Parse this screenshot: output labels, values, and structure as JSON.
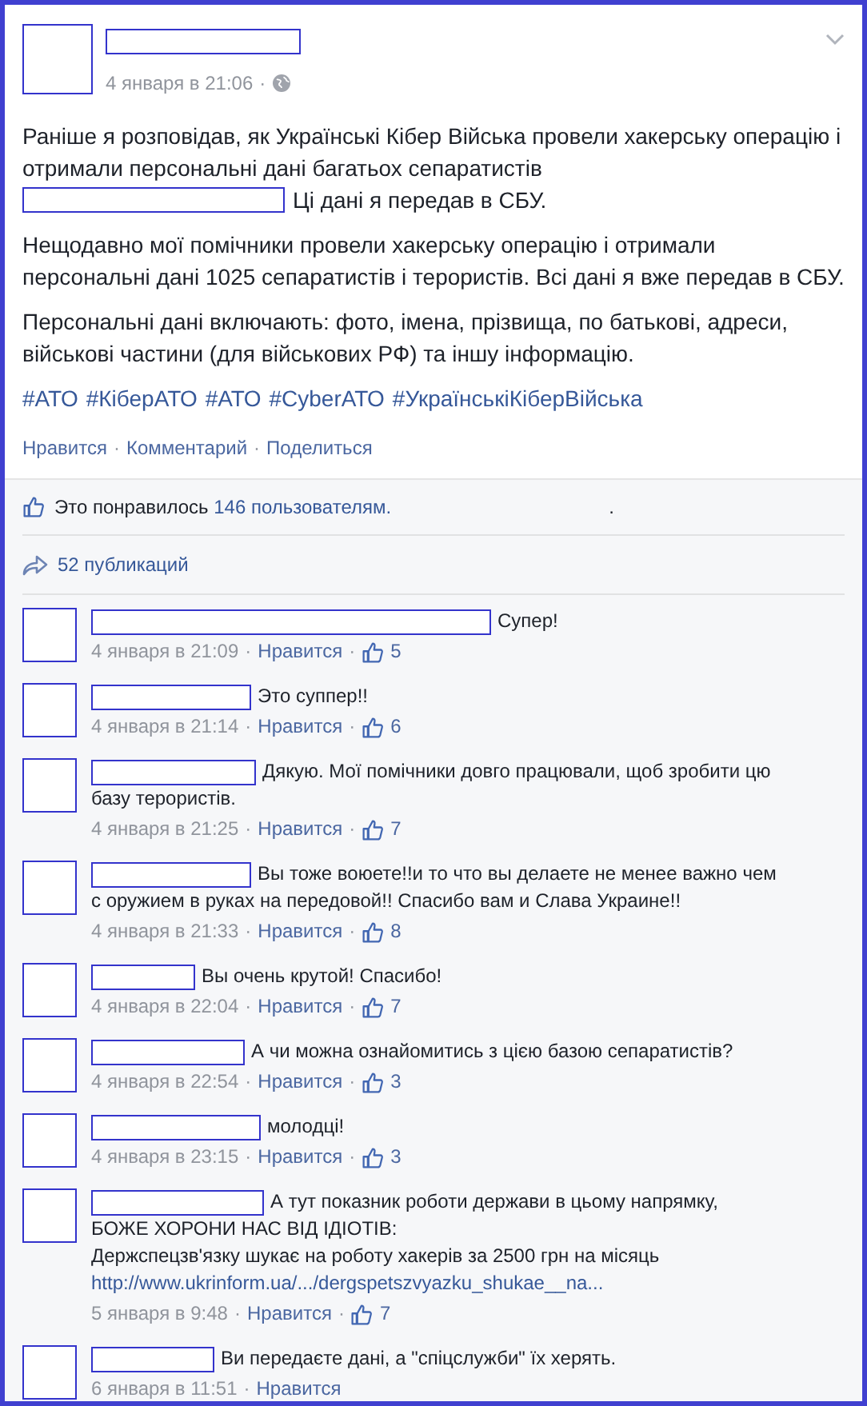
{
  "separator": "·",
  "post": {
    "time": "4 января в 21:06",
    "paragraphs": [
      [
        "Раніше я розповідав, як Українські Кібер Війська провели хакерську операцію і отримали персональні дані багатьох сепаратистів",
        "Ці дані я передав в СБУ."
      ],
      [
        "Нещодавно мої помічники провели хакерську операцію і отримали персональні дані 1025 сепаратистів і терористів. Всі дані я вже передав в СБУ."
      ],
      [
        "Персональні дані включають: фото, імена, прізвища, по батькові, адреси, військові частини (для військових РФ) та іншу інформацію."
      ]
    ],
    "hashtags": [
      "#АТО",
      "#КіберАТО",
      "#АТО",
      "#CyberАТО",
      "#УкраїнськіКіберВійська"
    ],
    "actions": [
      "Нравится",
      "Комментарий",
      "Поделиться"
    ]
  },
  "likes": {
    "prefix": "Это понравилось",
    "link": "146 пользователям.",
    "dot": "."
  },
  "shares": "52 публикаций",
  "comments": [
    {
      "lines": [
        "Супер!"
      ],
      "time": "4 января в 21:09",
      "like": "Нравится",
      "likes": "5"
    },
    {
      "lines": [
        "Это суппер!!"
      ],
      "time": "4 января в 21:14",
      "like": "Нравится",
      "likes": "6"
    },
    {
      "lines": [
        "Дякую. Мої помічники довго працювали, щоб зробити цю",
        "базу терористів."
      ],
      "time": "4 января в 21:25",
      "like": "Нравится",
      "likes": "7"
    },
    {
      "lines": [
        "Вы тоже воюете!!и то что вы делаете не менее важно чем",
        "с оружием в руках на передовой!! Спасибо вам и Слава Украине!!"
      ],
      "time": "4 января в 21:33",
      "like": "Нравится",
      "likes": "8"
    },
    {
      "lines": [
        "Вы очень крутой! Спасибо!"
      ],
      "time": "4 января в 22:04",
      "like": "Нравится",
      "likes": "7"
    },
    {
      "lines": [
        "А чи можна ознайомитись з цією базою сепаратистів?"
      ],
      "time": "4 января в 22:54",
      "like": "Нравится",
      "likes": "3"
    },
    {
      "lines": [
        "молодці!"
      ],
      "time": "4 января в 23:15",
      "like": "Нравится",
      "likes": "3"
    },
    {
      "lines": [
        "А тут показник роботи держави в цьому напрямку,",
        "БОЖЕ ХОРОНИ НАС ВІД ІДІОТІВ:",
        "Держспецзв'язку шукає на роботу хакерів за 2500 грн на місяць"
      ],
      "link": "http://www.ukrinform.ua/.../dergspetszvyazku_shukae__na...",
      "time": "5 января в 9:48",
      "like": "Нравится",
      "likes": "7"
    },
    {
      "lines": [
        "Ви передаєте дані, а \"спіцслужби\" їх херять."
      ],
      "time": "6 января в 11:51",
      "like": "Нравится"
    }
  ]
}
